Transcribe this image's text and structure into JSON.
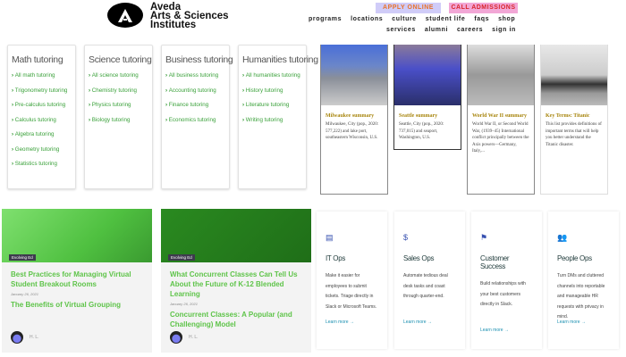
{
  "header": {
    "logo_lines": [
      "Aveda",
      "Arts & Sciences",
      "Institutes"
    ],
    "apply_label": "APPLY ONLINE",
    "call_label": "CALL ADMISSIONS",
    "nav_primary": [
      "programs",
      "locations",
      "culture",
      "student life",
      "faqs",
      "shop"
    ],
    "nav_secondary": [
      "services",
      "alumni",
      "careers",
      "sign in"
    ]
  },
  "tutoring": [
    {
      "title": "Math tutoring",
      "links": [
        "All math tutoring",
        "Trigonometry tutoring",
        "Pre-calculus tutoring",
        "Calculus tutoring",
        "Algebra tutoring",
        "Geometry tutoring",
        "Statistics tutoring"
      ]
    },
    {
      "title": "Science tutoring",
      "links": [
        "All science tutoring",
        "Chemistry tutoring",
        "Physics tutoring",
        "Biology tutoring"
      ]
    },
    {
      "title": "Business tutoring",
      "links": [
        "All business tutoring",
        "Accounting tutoring",
        "Finance tutoring",
        "Economics tutoring"
      ]
    },
    {
      "title": "Humanities tutoring",
      "links": [
        "All humanities tutoring",
        "History tutoring",
        "Literature tutoring",
        "Writing tutoring"
      ]
    }
  ],
  "summaries": [
    {
      "title": "Milwaukee summary",
      "text": "Milwaukee, City (pop., 2020: 577,222) and lake port, southeastern Wisconsin, U.S."
    },
    {
      "title": "Seattle summary",
      "text": "Seattle, City (pop., 2020: 737,015) and seaport, Washington, U.S."
    },
    {
      "title": "World War II summary",
      "text": "World War II, or Second World War, (1939–45) International conflict principally between the Axis powers—Germany, Italy,..."
    },
    {
      "title": "Key Terms: Titanic",
      "text": "This list provides definitions of important terms that will help you better understand the Titanic disaster."
    }
  ],
  "articles": [
    {
      "tag": "Evolving Ed",
      "title": "Best Practices for Managing Virtual Student Breakout Rooms",
      "date": "January 26, 2021",
      "subtitle": "The Benefits of Virtual Grouping",
      "author": "H. L."
    },
    {
      "tag": "Evolving Ed",
      "title": "What Concurrent Classes Can Tell Us About the Future of K-12 Blended Learning",
      "date": "January 26, 2021",
      "subtitle": "Concurrent Classes: A Popular (and Challenging) Model",
      "author": "H. L."
    }
  ],
  "ops": [
    {
      "icon": "ticket-icon",
      "title": "IT Ops",
      "text": "Make it easier for employees to submit tickets. Triage directly in Slack or Microsoft Teams.",
      "link": "Learn more →"
    },
    {
      "icon": "dollar-icon",
      "title": "Sales Ops",
      "text": "Automate tedious deal desk tasks and coast through quarter-end.",
      "link": "Learn more →"
    },
    {
      "icon": "flag-icon",
      "title": "Customer Success",
      "text": "Build relationships with your best customers directly in Slack.",
      "link": "Learn more →"
    },
    {
      "icon": "people-icon",
      "title": "People Ops",
      "text": "Turn DMs and cluttered channels into reportable and manageable HR requests with privacy in mind.",
      "link": "Learn more →"
    }
  ]
}
